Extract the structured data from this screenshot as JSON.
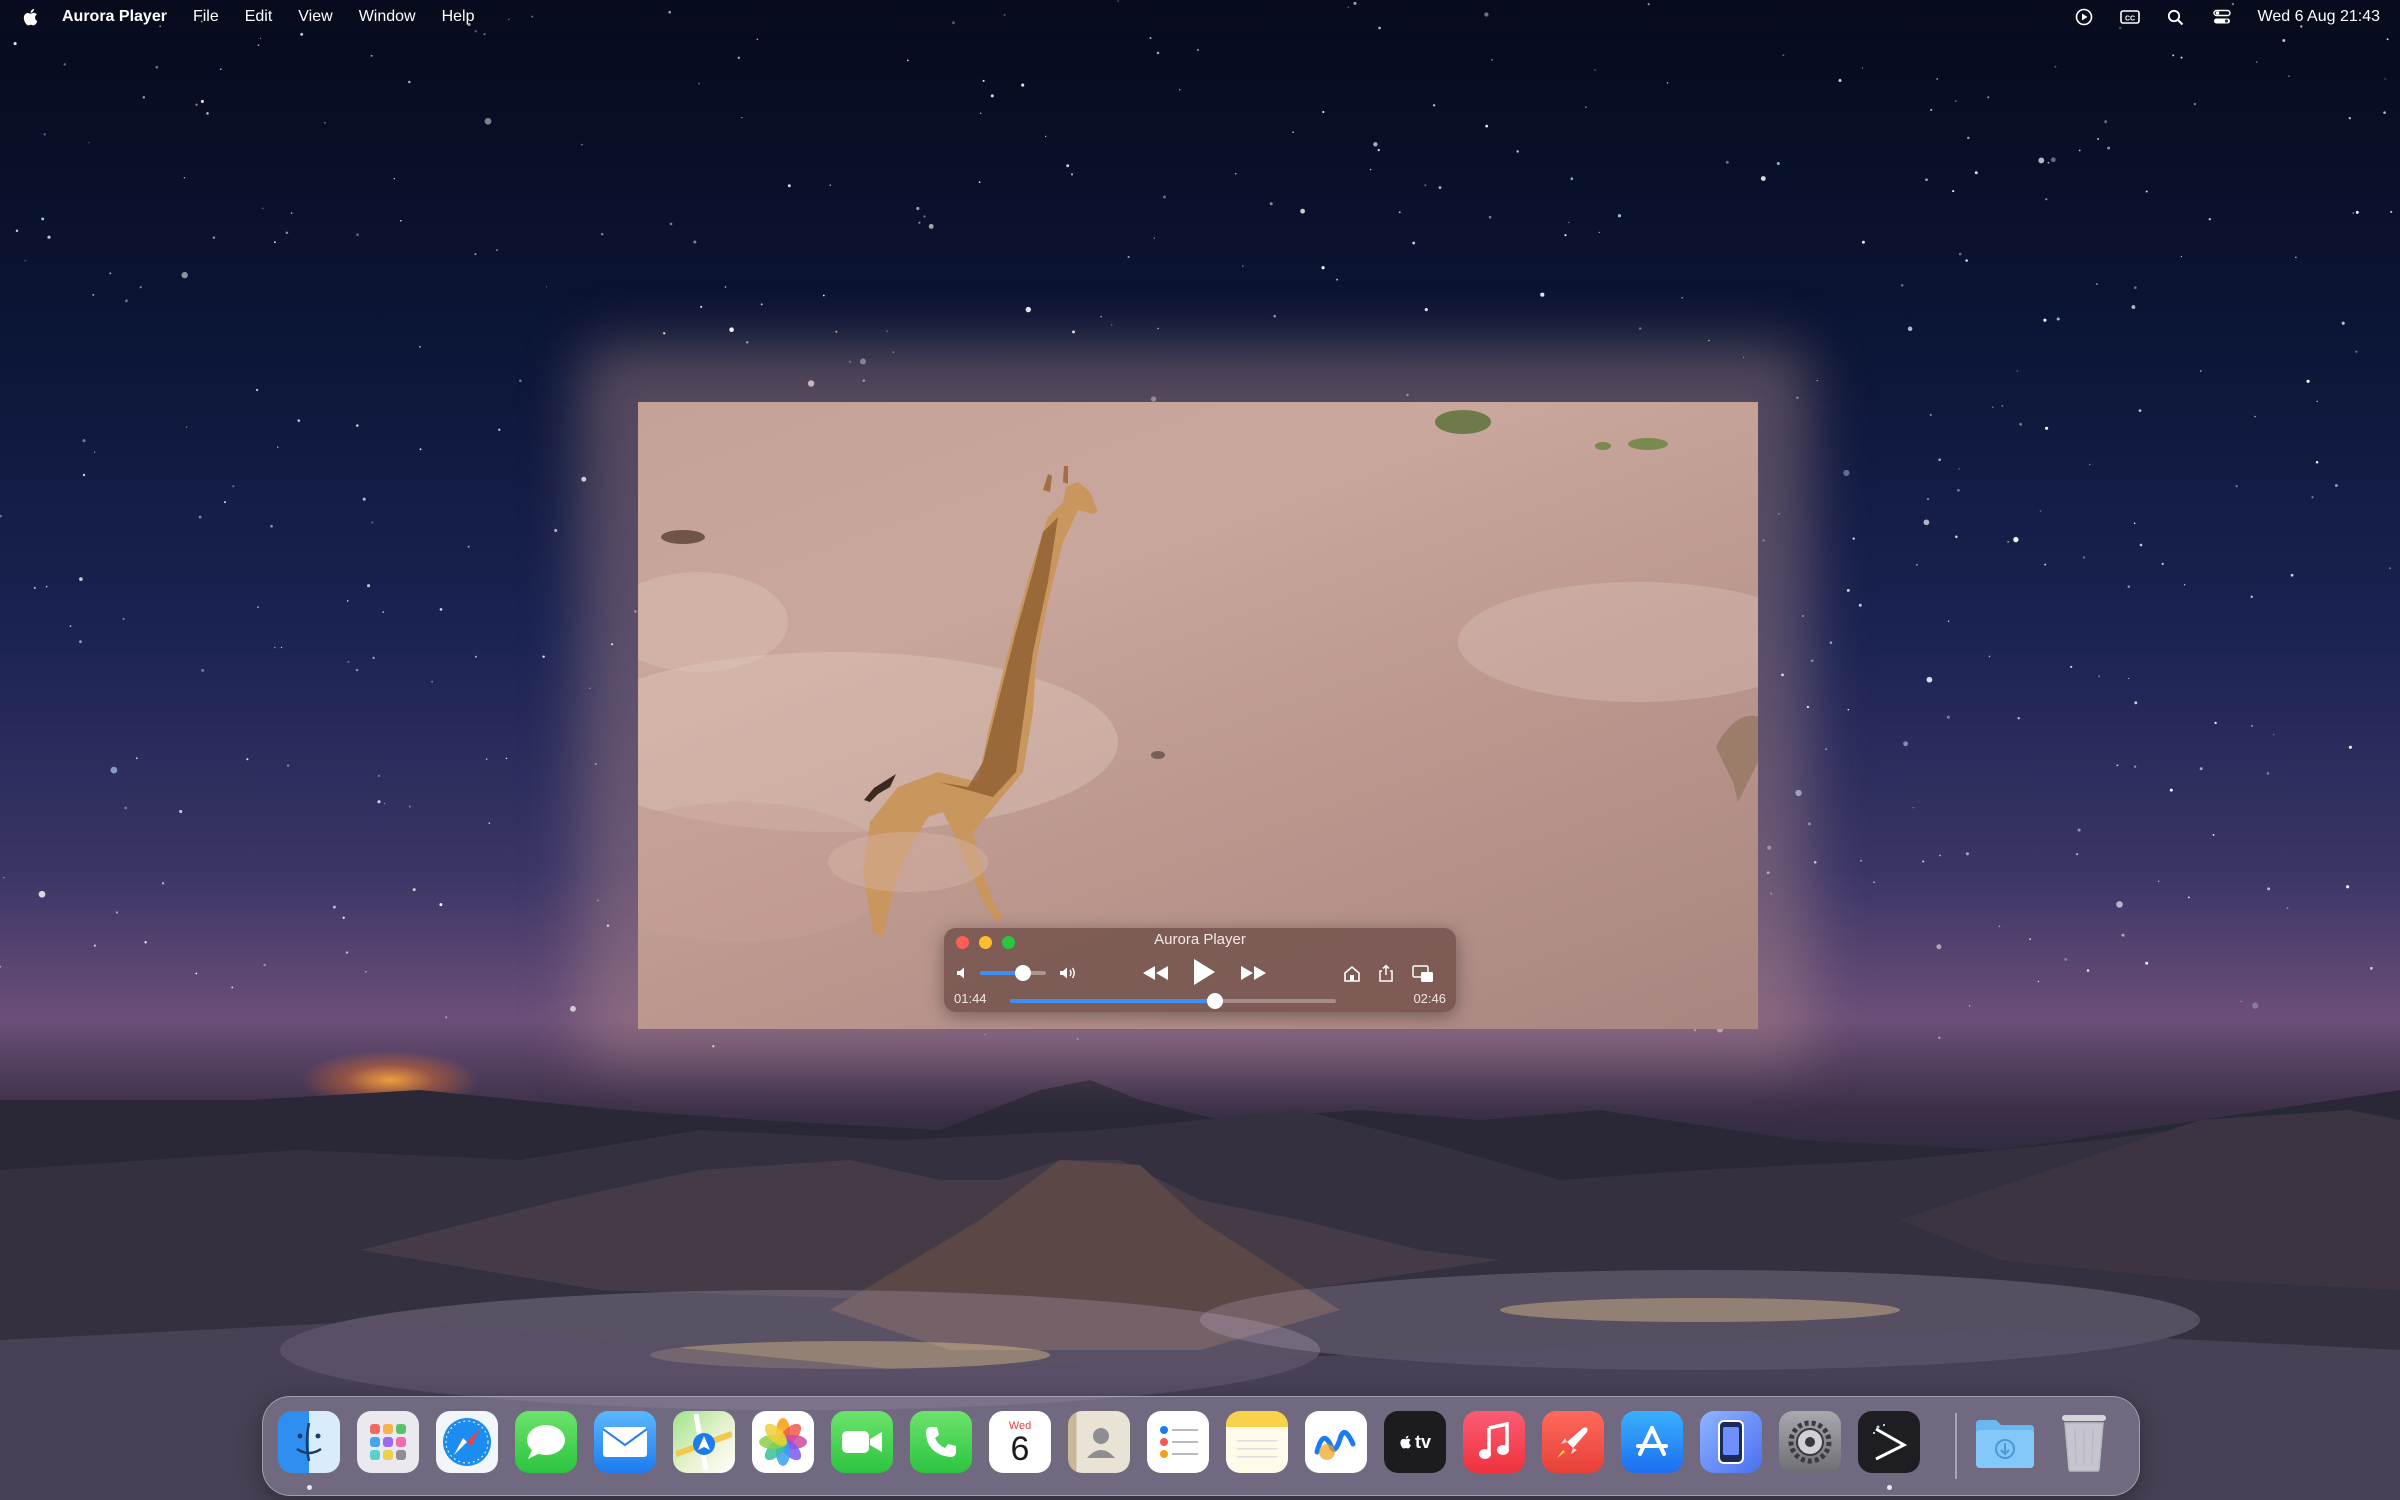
{
  "menubar": {
    "app_name": "Aurora Player",
    "menus": [
      "File",
      "Edit",
      "View",
      "Window",
      "Help"
    ],
    "status_icons": [
      "play-circle-icon",
      "caption-icon",
      "search-icon",
      "control-center-icon"
    ],
    "clock": "Wed 6 Aug 21:43"
  },
  "player": {
    "window_title": "Aurora Player",
    "current_time": "01:44",
    "total_time": "02:46",
    "progress_fraction": 0.63,
    "volume_fraction": 0.65,
    "controls": [
      "volume-low-icon",
      "volume-high-icon",
      "rewind-icon",
      "play-icon",
      "fast-forward-icon",
      "airplay-icon",
      "share-icon",
      "picture-in-picture-icon"
    ]
  },
  "dock": {
    "calendar_day": "Wed",
    "calendar_date": "6",
    "apps": [
      "Finder",
      "Launchpad",
      "Safari",
      "Messages",
      "Mail",
      "Maps",
      "Photos",
      "FaceTime",
      "Phone",
      "Calendar",
      "Contacts",
      "Reminders",
      "Notes",
      "Freeform",
      "TV",
      "Music",
      "Rocket",
      "App Store",
      "iPhone Mirroring",
      "System Settings",
      "Aurora Player",
      "Downloads",
      "Trash"
    ],
    "tv_label": "tv"
  },
  "colors": {
    "accent": "#3d8ef7",
    "close": "#ff5f57",
    "minimize": "#febc2e",
    "zoom": "#28c840"
  }
}
